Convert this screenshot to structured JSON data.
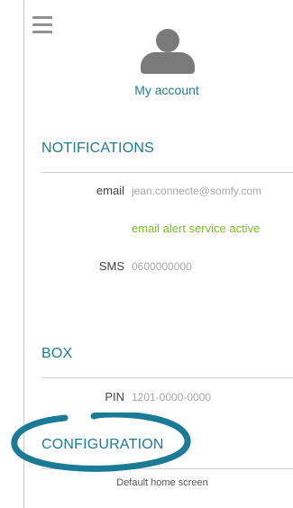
{
  "header": {
    "menu_icon": "hamburger-menu-icon",
    "avatar_icon": "user-avatar-icon",
    "account_title": "My account"
  },
  "notifications": {
    "title": "NOTIFICATIONS",
    "email_label": "email",
    "email_value": "jean.connecte@somfy.com",
    "email_status": "email alert service active",
    "sms_label": "SMS",
    "sms_value": "0600000000"
  },
  "box": {
    "title": "BOX",
    "pin_label": "PIN",
    "pin_value": "1201-0000-0000"
  },
  "configuration": {
    "title": "CONFIGURATION",
    "default_home_label": "Default home screen"
  },
  "colors": {
    "accent": "#1b7a96",
    "status_active": "#7dbb29",
    "highlight_ring": "#1b7a96"
  }
}
